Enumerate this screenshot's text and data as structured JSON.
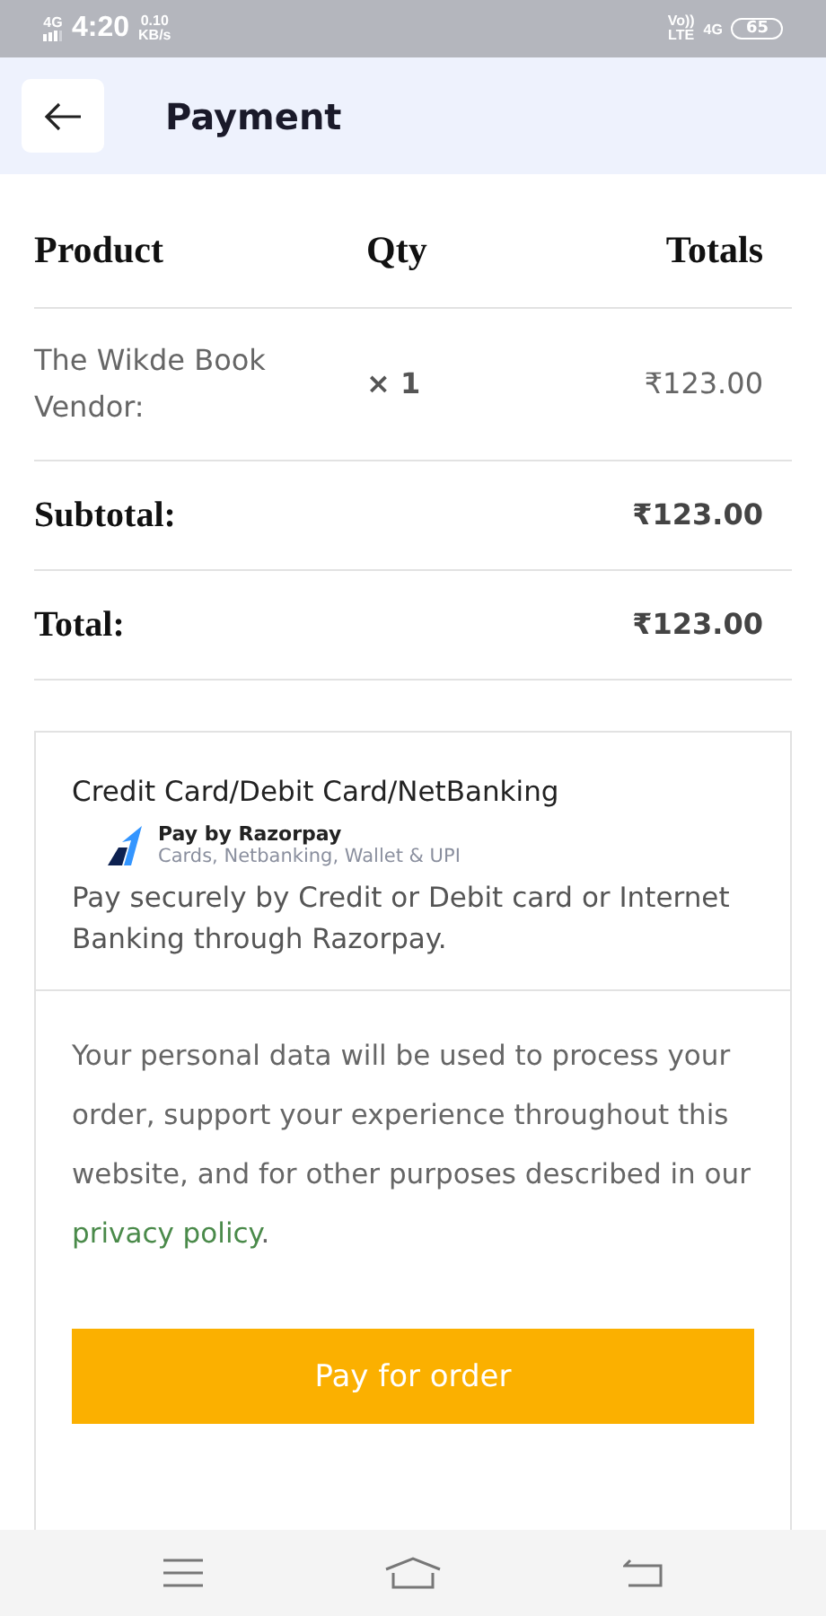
{
  "status_bar": {
    "network": "4G",
    "time": "4:20",
    "speed_value": "0.10",
    "speed_unit": "KB/s",
    "volte": "Vo))",
    "lte": "LTE",
    "network_right": "4G",
    "battery": "65"
  },
  "header": {
    "title": "Payment"
  },
  "order_table": {
    "columns": [
      "Product",
      "Qty",
      "Totals"
    ],
    "rows": [
      {
        "kind": "item",
        "product": "The Wikde Book Vendor:",
        "qty": "× 1",
        "total": "₹123.00"
      },
      {
        "kind": "summary",
        "product": "Subtotal:",
        "total": "₹123.00"
      },
      {
        "kind": "summary",
        "product": "Total:",
        "total": "₹123.00"
      }
    ]
  },
  "payment_method": {
    "title": "Credit Card/Debit Card/NetBanking",
    "provider": "Pay by Razorpay",
    "provider_subtitle": "Cards, Netbanking, Wallet & UPI",
    "description": "Pay securely by Credit or Debit card or Internet Banking through Razorpay."
  },
  "privacy": {
    "text_before": "Your personal data will be used to process your order, support your experience throughout this website, and for other purposes described in our ",
    "link": "privacy policy",
    "text_after": "."
  },
  "pay_button": {
    "label": "Pay for order"
  }
}
